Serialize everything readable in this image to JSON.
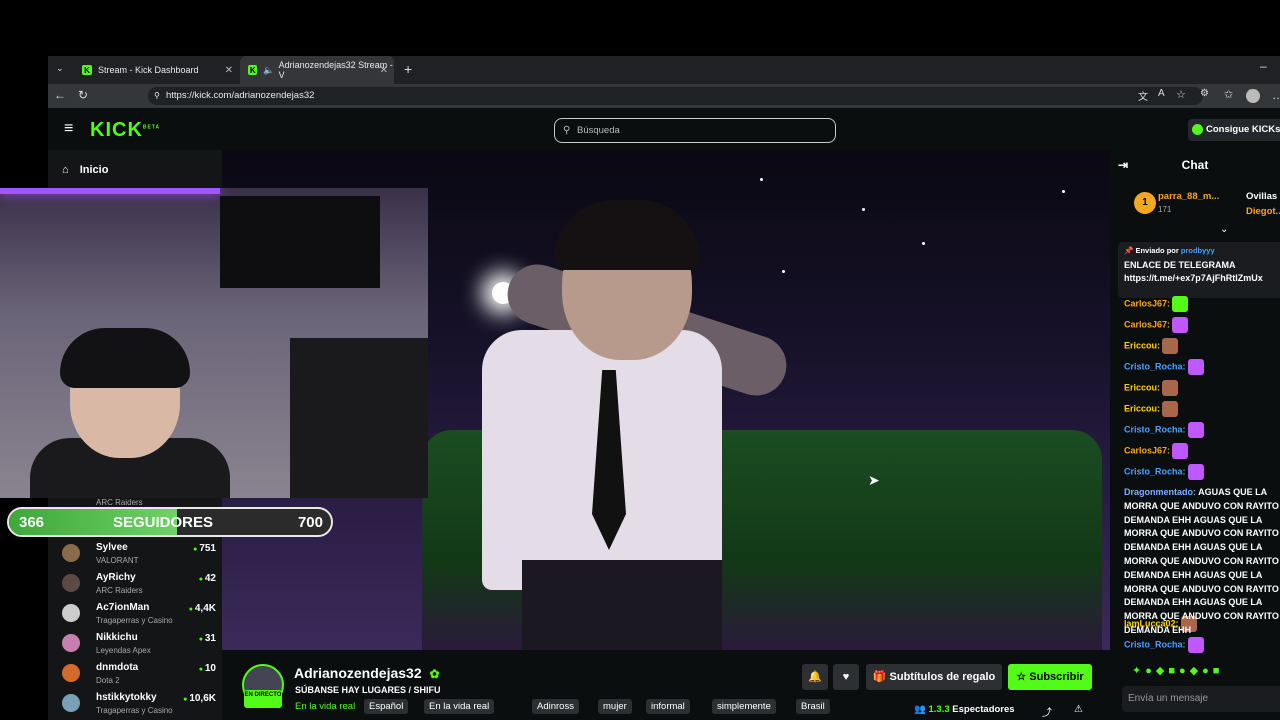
{
  "browser": {
    "tabs": [
      {
        "title": "Stream - Kick Dashboard"
      },
      {
        "title": "Adrianozendejas32 Stream - V"
      }
    ],
    "url": "https://kick.com/adrianozendejas32"
  },
  "kick": {
    "logo": "KICK",
    "logo_badge": "BETA",
    "search_placeholder": "Búsqueda",
    "cta": "Consigue KICKs",
    "home_label": "Inicio"
  },
  "sidebar": {
    "recommended": [
      {
        "name": "",
        "category": "ARC Raiders",
        "viewers": ""
      },
      {
        "name": "Sylvee",
        "category": "VALORANT",
        "viewers": "751"
      },
      {
        "name": "AyRichy",
        "category": "ARC Raiders",
        "viewers": "42"
      },
      {
        "name": "Ac7ionMan",
        "category": "Tragaperras y Casino",
        "viewers": "4,4K"
      },
      {
        "name": "Nikkichu",
        "category": "Leyendas Apex",
        "viewers": "31"
      },
      {
        "name": "dnmdota",
        "category": "Dota 2",
        "viewers": "10"
      },
      {
        "name": "hstikkytokky",
        "category": "Tragaperras y Casino",
        "viewers": "10,6K"
      }
    ]
  },
  "follower_goal": {
    "current": "366",
    "label": "SEGUIDORES",
    "goal": "700",
    "progress": 0.523
  },
  "channel": {
    "name": "Adrianozendejas32",
    "live_badge": "EN DIRECTO",
    "title": "SÚBANSE HAY LUGARES / SHIFU",
    "category": "En la vida real",
    "tags": [
      "Español",
      "En la vida real",
      "Adinross",
      "mujer",
      "informal",
      "simplemente",
      "Brasil"
    ],
    "gift_subs_label": "Subtítulos de regalo",
    "subscribe_label": "Subscribir",
    "viewers_label": "Espectadores",
    "viewers_count": "1.3.3"
  },
  "chat": {
    "title": "Chat",
    "leaderboard": [
      {
        "rank": "1",
        "name": "parra_88_m...",
        "points": "171"
      },
      {
        "name": "Ovillas"
      },
      {
        "name": "Diegot..."
      }
    ],
    "pinned": {
      "sent_by": "Enviado por",
      "author": "prodbyyy",
      "line1": "ENLACE DE TELEGRAMA",
      "line2": "https://t.me/+ex7p7AjFhRtlZmUx"
    },
    "messages": [
      {
        "user": "CarlosJ67:",
        "color": "#f5a623"
      },
      {
        "user": "CarlosJ67:",
        "color": "#f5a623"
      },
      {
        "user": "Ericcou:",
        "color": "#ffd000"
      },
      {
        "user": "Cristo_Rocha:",
        "color": "#4ca0ff"
      },
      {
        "user": "Ericcou:",
        "color": "#ffd000"
      },
      {
        "user": "Ericcou:",
        "color": "#ffd000"
      },
      {
        "user": "Cristo_Rocha:",
        "color": "#4ca0ff"
      },
      {
        "user": "CarlosJ67:",
        "color": "#f5a623"
      },
      {
        "user": "Cristo_Rocha:",
        "color": "#4ca0ff"
      }
    ],
    "long_message_user": "Dragonmentado:",
    "long_message": "AGUAS QUE LA MORRA QUE ANDUVO CON RAYITO DEMANDA EHH AGUAS QUE LA MORRA QUE ANDUVO CON RAYITO DEMANDA EHH AGUAS QUE LA MORRA QUE ANDUVO CON RAYITO DEMANDA EHH AGUAS QUE LA MORRA QUE ANDUVO CON RAYITO DEMANDA EHH AGUAS QUE LA MORRA QUE ANDUVO CON RAYITO DEMANDA EHH",
    "after_messages": [
      {
        "user": "IamLucca02:",
        "color": "#ffd000"
      },
      {
        "user": "Cristo_Rocha:",
        "color": "#4ca0ff"
      }
    ],
    "input_placeholder": "Envía un mensaje"
  },
  "colors": {
    "brand": "#53fc18",
    "bg": "#0b0e0f"
  }
}
